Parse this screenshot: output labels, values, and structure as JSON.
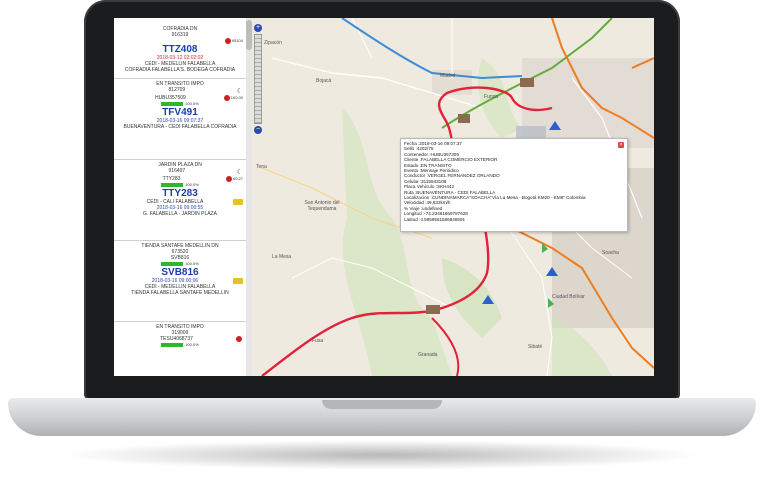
{
  "sidebar": {
    "cards": [
      {
        "header": "COFRADIA DN",
        "id": "916319",
        "vehicle": "TTZ408",
        "plate": "TTZ408",
        "date": "2018-03-12 02:02:02",
        "route": "CEDI - MEDELLIN FALABELLA",
        "dest": "COFRADIA FALABELLA'S. BODEGA COFRADIA",
        "mini": "95104"
      },
      {
        "header": "EN TRANSITO IMPO",
        "id": "812709",
        "vehicle": "HUBU357509",
        "plate": "TFV491",
        "date": "2018-03-16 09:07:37",
        "route": "BUENAVENTURA - CEDI FALABELLA",
        "dest": "BUENAVENTURA - CEDI FALABELLA COFRADIA",
        "pct": "100.0%",
        "mini": "100.00"
      },
      {
        "header": "JARDIN PLAZA DN",
        "id": "916497",
        "vehicle": "TTY283",
        "plate": "TTY283",
        "date": "2018-03-16 09:00:55",
        "route": "CEDI - CALI FALABELLA",
        "dest": "G. FALABELLA - JARDIN PLAZA",
        "pct": "100.0%",
        "mini": "00:27"
      },
      {
        "header": "TIENDA SANTAFE MEDELLIN DN",
        "id": "673520",
        "vehicle": "SVB816",
        "plate": "SVB816",
        "date": "2018-03-16 09:00:06",
        "route": "CEDI - MEDELLIN FALABELLA",
        "dest": "TIENDA FALABELLA SANTAFE MEDELLIN",
        "pct": "100.0%"
      },
      {
        "header": "EN TRANSITO IMPO",
        "id": "319009",
        "vehicle": "TESU4068737",
        "pct": "100.0%"
      }
    ]
  },
  "map": {
    "labels": {
      "zipacon": "Zipacón",
      "bojaca": "Bojacá",
      "madrid": "Madrid",
      "funza": "Funza",
      "tena": "Tena",
      "san_antonio": "San Antonio del Tequendama",
      "soacha": "Soacha",
      "ciudad_bolivar": "Ciudad Bolívar",
      "sibate": "Sibaté",
      "granada": "Granada",
      "la_mesa": "La Mesa",
      "fusa": "Fusa"
    },
    "popup": {
      "close": "×",
      "lines": [
        "Fecha :2018-03-16 09:07:37",
        "Sello :4202/75",
        "Contenedor :HUBU357309",
        "Cliente :FALABELLA COMERCIO EXTERIOR",
        "Estado :EN TRANSITO",
        "Evento :Mensaje Periódico",
        "Conductor :VERGEL FERNANDEZ ORLANDO",
        "Celular :3115843108",
        "Placa Vehículo :SKH442",
        "Ruta :BUENAVENTURA - CEDI FALABELLA",
        "Localizacion :CUNDINAMARCA\"SOACHA\"Vía La Mesa - Bogotá KM20 - KM6\" Colombia",
        "Velocidad :49,832km/h",
        "% Viaje :undefined",
        "Longitud :-74.23461669787628",
        "Latitud :4.5958561586848591"
      ]
    },
    "zoom": {
      "plus": "+",
      "minus": "−"
    }
  },
  "colors": {
    "plate": "#1b3ea8",
    "date": "#c8302a",
    "route_red": "#e0233a",
    "road_blue": "#3f8bd6",
    "road_orange": "#ee7d1f",
    "road_green": "#5fae3a",
    "bar": "#31b531"
  }
}
